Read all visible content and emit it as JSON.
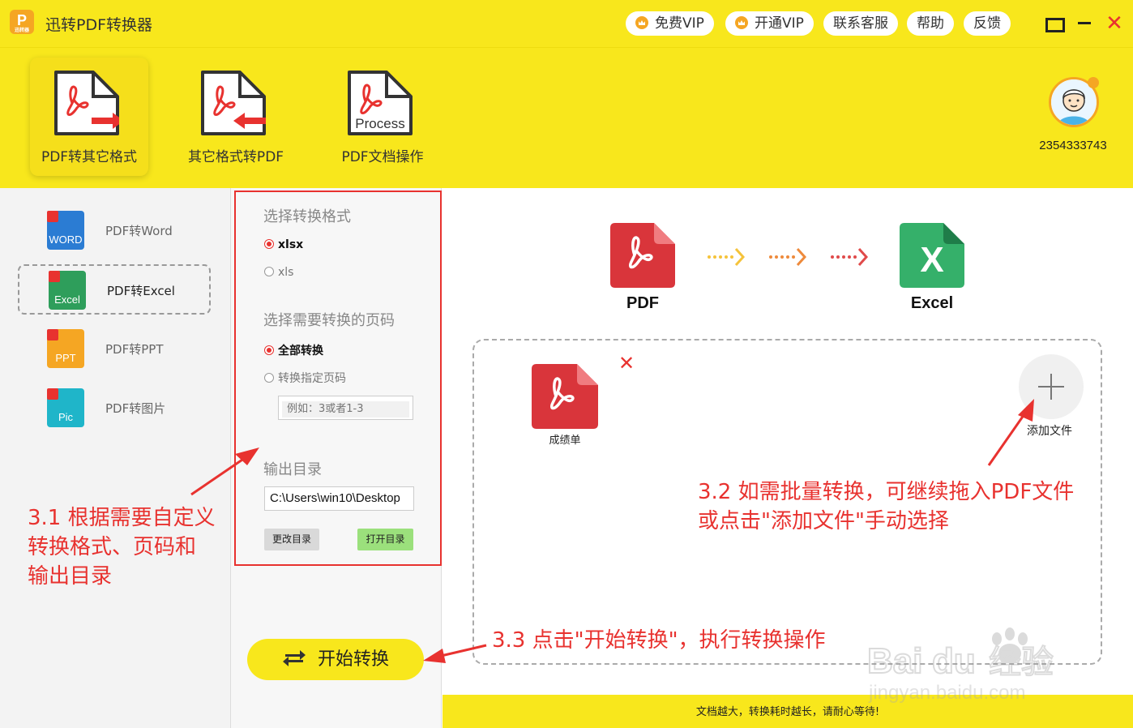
{
  "app": {
    "title": "迅转PDF转换器",
    "logo_letter": "P",
    "logo_sub": "迅转器"
  },
  "header": {
    "buttons": [
      {
        "label": "免费VIP",
        "icon": "crown-icon"
      },
      {
        "label": "开通VIP",
        "icon": "crown-icon"
      },
      {
        "label": "联系客服"
      },
      {
        "label": "帮助"
      },
      {
        "label": "反馈"
      }
    ],
    "window_controls": [
      "maximize-icon",
      "minimize-icon",
      "close-icon"
    ]
  },
  "toolbar": {
    "tools": [
      {
        "label": "PDF转其它格式",
        "active": true
      },
      {
        "label": "其它格式转PDF",
        "active": false
      },
      {
        "label": "PDF文档操作",
        "active": false,
        "icon_text": "Process"
      }
    ],
    "user_id": "2354333743"
  },
  "sidebar": {
    "items": [
      {
        "label": "PDF转Word",
        "tag": "WORD",
        "color": "#2b7cd3"
      },
      {
        "label": "PDF转Excel",
        "tag": "Excel",
        "color": "#2e9e5b",
        "selected": true
      },
      {
        "label": "PDF转PPT",
        "tag": "PPT",
        "color": "#f5a623"
      },
      {
        "label": "PDF转图片",
        "tag": "Pic",
        "color": "#1fb5c9"
      }
    ]
  },
  "options": {
    "format_heading": "选择转换格式",
    "formats": [
      {
        "label": "xlsx",
        "checked": true
      },
      {
        "label": "xls",
        "checked": false
      }
    ],
    "pages_heading": "选择需要转换的页码",
    "pages": [
      {
        "label": "全部转换",
        "checked": true
      },
      {
        "label": "转换指定页码",
        "checked": false
      }
    ],
    "page_placeholder": "例如：3或者1-3",
    "output_heading": "输出目录",
    "output_dir": "C:\\Users\\win10\\Desktop",
    "change_dir_label": "更改目录",
    "open_dir_label": "打开目录",
    "start_label": "开始转换"
  },
  "main": {
    "from_label": "PDF",
    "to_label": "Excel",
    "to_letter": "X",
    "files": [
      {
        "name": "成绩单"
      }
    ],
    "add_file_label": "添加文件",
    "status_text": "文档越大，转换耗时越长，请耐心等待!"
  },
  "annotations": {
    "note_31": [
      "3.1 根据需要自定义",
      "转换格式、页码和",
      "输出目录"
    ],
    "note_32": [
      "3.2 如需批量转换，可继续拖入PDF文件",
      "或点击\"添加文件\"手动选择"
    ],
    "note_33": "3.3 点击\"开始转换\"，执行转换操作"
  },
  "colors": {
    "brand_yellow": "#f8e71c",
    "pdf_red": "#d9353b",
    "excel_green": "#35b06a",
    "annotation_red": "#e8322f"
  }
}
